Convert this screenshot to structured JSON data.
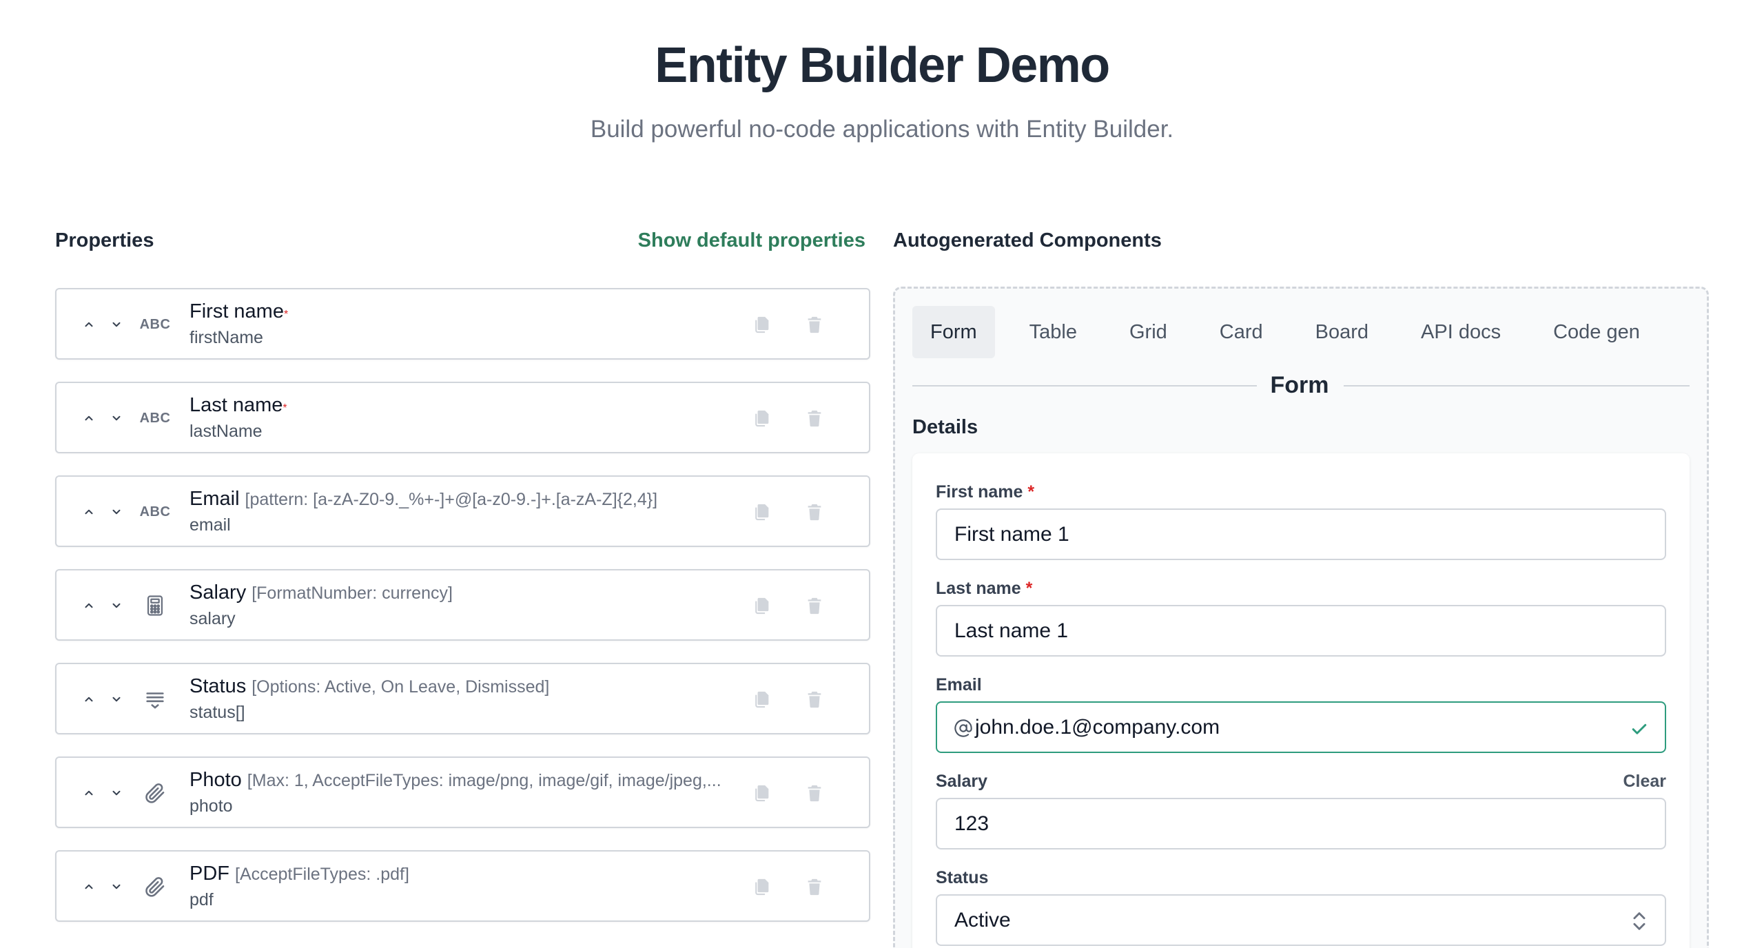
{
  "header": {
    "title": "Entity Builder Demo",
    "subtitle": "Build powerful no-code applications with Entity Builder."
  },
  "properties_panel": {
    "title": "Properties",
    "show_default_label": "Show default properties",
    "items": [
      {
        "label": "First name",
        "required": "*",
        "meta": "",
        "key": "firstName",
        "type_icon": "abc-text-icon",
        "type_text": "ABC"
      },
      {
        "label": "Last name",
        "required": "*",
        "meta": "",
        "key": "lastName",
        "type_icon": "abc-text-icon",
        "type_text": "ABC"
      },
      {
        "label": "Email",
        "required": "",
        "meta": "[pattern: [a-zA-Z0-9._%+-]+@[a-z0-9.-]+.[a-zA-Z]{2,4}]",
        "key": "email",
        "type_icon": "abc-text-icon",
        "type_text": "ABC"
      },
      {
        "label": "Salary",
        "required": "",
        "meta": "[FormatNumber: currency]",
        "key": "salary",
        "type_icon": "calculator-icon",
        "type_text": ""
      },
      {
        "label": "Status",
        "required": "",
        "meta": "[Options: Active, On Leave, Dismissed]",
        "key": "status[]",
        "type_icon": "select-list-icon",
        "type_text": ""
      },
      {
        "label": "Photo",
        "required": "",
        "meta": "[Max: 1, AcceptFileTypes: image/png, image/gif, image/jpeg,...",
        "key": "photo",
        "type_icon": "paperclip-icon",
        "type_text": ""
      },
      {
        "label": "PDF",
        "required": "",
        "meta": "[AcceptFileTypes: .pdf]",
        "key": "pdf",
        "type_icon": "paperclip-icon",
        "type_text": ""
      }
    ]
  },
  "components_panel": {
    "title": "Autogenerated Components",
    "tabs": [
      "Form",
      "Table",
      "Grid",
      "Card",
      "Board",
      "API docs",
      "Code gen"
    ],
    "active_tab": "Form",
    "section_heading": "Form",
    "details_title": "Details",
    "form": {
      "first_name": {
        "label": "First name",
        "required": "*",
        "value": "First name 1"
      },
      "last_name": {
        "label": "Last name",
        "required": "*",
        "value": "Last name 1"
      },
      "email": {
        "label": "Email",
        "value": "john.doe.1@company.com"
      },
      "salary": {
        "label": "Salary",
        "value": "123",
        "clear_label": "Clear"
      },
      "status": {
        "label": "Status",
        "value": "Active"
      }
    }
  },
  "colors": {
    "accent_green": "#2e7d5b",
    "required_red": "#dc2626",
    "valid_border": "#2e9c7e",
    "border_gray": "#d1d5db"
  }
}
